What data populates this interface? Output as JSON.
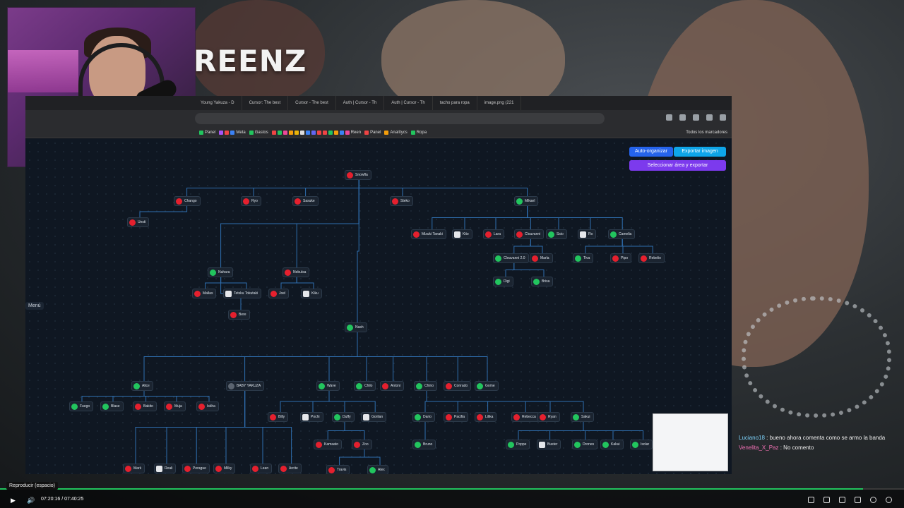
{
  "overlay": {
    "title": "REENZ"
  },
  "browser": {
    "tabs": [
      "Young Yakuza - D",
      "Cursor: The best",
      "Cursor - The best",
      "Auth | Cursor - Th",
      "Auth | Cursor - Th",
      "tacho para ropa",
      "image.png (221"
    ],
    "bookmarks": [
      "Panel",
      "Meta",
      "Gastos",
      "Reen",
      "Panel",
      "Analítycs",
      "Ropa"
    ],
    "bookmarks_right": "Todos los marcadores"
  },
  "app": {
    "auto_organize": "Auto-organizar",
    "export_image": "Exportar imagen",
    "select_export": "Seleccionar área y exportar",
    "menu": "Menú"
  },
  "tree_nodes": [
    {
      "label": "Snowfla",
      "color": "red"
    },
    {
      "label": "Chango",
      "color": "red"
    },
    {
      "label": "Ryo",
      "color": "red"
    },
    {
      "label": "Sasuke",
      "color": "red"
    },
    {
      "label": "Steko",
      "color": "red"
    },
    {
      "label": "Mikael",
      "color": "green"
    },
    {
      "label": "Uesti",
      "color": "red"
    },
    {
      "label": "Mizuki Tanaki",
      "color": "red"
    },
    {
      "label": "Kito",
      "color": "person"
    },
    {
      "label": "Lara",
      "color": "red"
    },
    {
      "label": "Clouvanni",
      "color": "red"
    },
    {
      "label": "Ssio",
      "color": "green"
    },
    {
      "label": "Ro",
      "color": "person"
    },
    {
      "label": "Camelia",
      "color": "green"
    },
    {
      "label": "Clouvanni 2.0",
      "color": "green"
    },
    {
      "label": "Marla",
      "color": "red"
    },
    {
      "label": "Tiva",
      "color": "green"
    },
    {
      "label": "Pipo",
      "color": "red"
    },
    {
      "label": "Rebelio",
      "color": "red"
    },
    {
      "label": "Digi",
      "color": "green"
    },
    {
      "label": "Brisa",
      "color": "green"
    },
    {
      "label": "Nahara",
      "color": "green"
    },
    {
      "label": "Nebulsa",
      "color": "red"
    },
    {
      "label": "Mallas",
      "color": "red"
    },
    {
      "label": "Tetsku Tokutaki",
      "color": "person"
    },
    {
      "label": "Joel",
      "color": "red"
    },
    {
      "label": "Kiku",
      "color": "person"
    },
    {
      "label": "Bere",
      "color": "red"
    },
    {
      "label": "Nash",
      "color": "green"
    },
    {
      "label": "Alice",
      "color": "green"
    },
    {
      "label": "BABY YAKUZA",
      "color": "gray"
    },
    {
      "label": "Wave",
      "color": "green"
    },
    {
      "label": "Chilo",
      "color": "green"
    },
    {
      "label": "Antoni",
      "color": "red"
    },
    {
      "label": "Chino",
      "color": "green"
    },
    {
      "label": "Conrado",
      "color": "red"
    },
    {
      "label": "Gome",
      "color": "green"
    },
    {
      "label": "Fuego",
      "color": "green"
    },
    {
      "label": "Blase",
      "color": "green"
    },
    {
      "label": "Bakito",
      "color": "red"
    },
    {
      "label": "Muja",
      "color": "red"
    },
    {
      "label": "Iskha",
      "color": "red"
    },
    {
      "label": "Billy",
      "color": "red"
    },
    {
      "label": "Pochi",
      "color": "person"
    },
    {
      "label": "Duffy",
      "color": "green"
    },
    {
      "label": "Gorilan",
      "color": "person"
    },
    {
      "label": "Dario",
      "color": "green"
    },
    {
      "label": "Pacifia",
      "color": "red"
    },
    {
      "label": "Lilika",
      "color": "red"
    },
    {
      "label": "Rebecca",
      "color": "red"
    },
    {
      "label": "Ryan",
      "color": "red"
    },
    {
      "label": "Sakui",
      "color": "green"
    },
    {
      "label": "Kamaato",
      "color": "red"
    },
    {
      "label": "Zoo",
      "color": "red"
    },
    {
      "label": "Bruno",
      "color": "green"
    },
    {
      "label": "Poppe",
      "color": "green"
    },
    {
      "label": "Buster",
      "color": "person"
    },
    {
      "label": "Drones",
      "color": "green"
    },
    {
      "label": "Kakui",
      "color": "green"
    },
    {
      "label": "Isolar",
      "color": "green"
    },
    {
      "label": "Mark",
      "color": "red"
    },
    {
      "label": "Reali",
      "color": "person"
    },
    {
      "label": "Perague",
      "color": "red"
    },
    {
      "label": "Milky",
      "color": "red"
    },
    {
      "label": "Lean",
      "color": "red"
    },
    {
      "label": "Arcite",
      "color": "red"
    },
    {
      "label": "Travis",
      "color": "red"
    },
    {
      "label": "Alex",
      "color": "green"
    }
  ],
  "chat": {
    "messages": [
      {
        "user": "Luciano18",
        "text": "bueno ahora comenta como se armo la banda"
      },
      {
        "user": "Venelita_X_Paz",
        "text": "No comento"
      }
    ]
  },
  "player": {
    "tooltip": "Reproducir (espacio)",
    "time": "07:20:16 / 07:40:25",
    "progress": 0.955
  }
}
